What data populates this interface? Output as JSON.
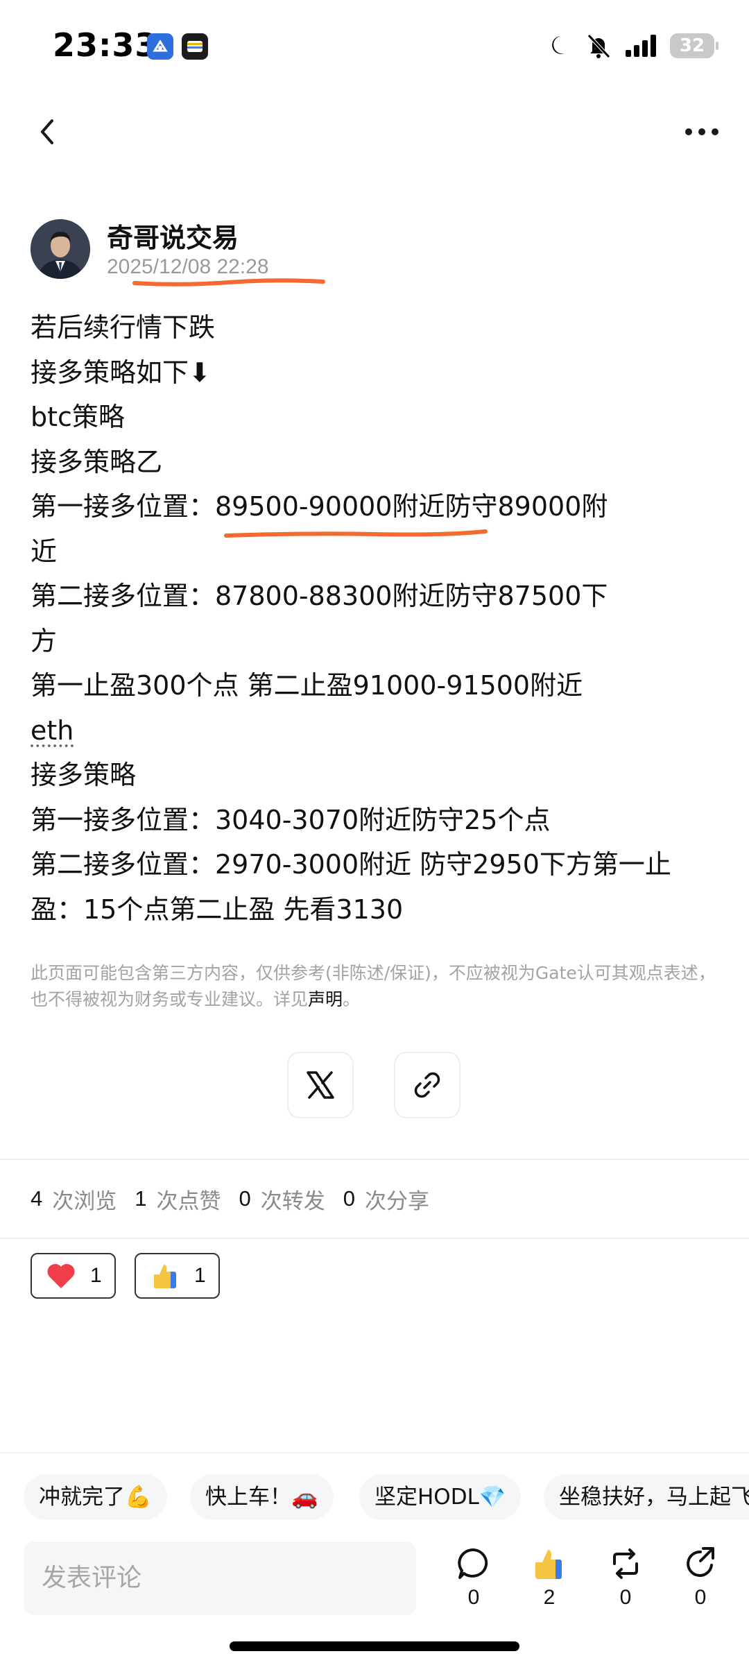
{
  "status_bar": {
    "time": "23:33",
    "battery": "32"
  },
  "author": {
    "name": "奇哥说交易",
    "time": "2025/12/08 22:28"
  },
  "post": {
    "lines": [
      "若后续行情下跌",
      "接多策略如下⬇",
      "btc策略",
      "接多策略乙",
      "第一接多位置：89500-90000附近防守89000附",
      "近",
      "第二接多位置：87800-88300附近防守87500下",
      "方",
      "第一止盈300个点 第二止盈91000-91500附近",
      "eth",
      "接多策略",
      "第一接多位置：3040-3070附近防守25个点",
      "第二接多位置：2970-3000附近 防守2950下方第一止",
      "盈：15个点第二止盈 先看3130"
    ]
  },
  "disclaimer": {
    "text": "此页面可能包含第三方内容，仅供参考(非陈述/保证)，不应被视为Gate认可其观点表述，也不得被视为财务或专业建议。详见",
    "link": "声明",
    "end": "。"
  },
  "stats": [
    {
      "num": "4",
      "label": "次浏览"
    },
    {
      "num": "1",
      "label": "次点赞"
    },
    {
      "num": "0",
      "label": "次转发"
    },
    {
      "num": "0",
      "label": "次分享"
    }
  ],
  "reactions": [
    {
      "icon": "heart-icon",
      "count": "1"
    },
    {
      "icon": "thumbs-up-icon",
      "count": "1"
    }
  ],
  "quick_phrases": [
    "冲就完了💪",
    "快上车！🚗",
    "坚定HODL💎",
    "坐稳扶好，马上起飞"
  ],
  "comment": {
    "placeholder": "发表评论"
  },
  "actions": [
    {
      "icon": "comment-icon",
      "count": "0"
    },
    {
      "icon": "like-icon",
      "count": "2"
    },
    {
      "icon": "repost-icon",
      "count": "0"
    },
    {
      "icon": "share-icon",
      "count": "0"
    }
  ],
  "colors": {
    "highlight": "#f36b2f",
    "chip_bg": "#f5f6f8",
    "heart": "#ef3e4a"
  }
}
